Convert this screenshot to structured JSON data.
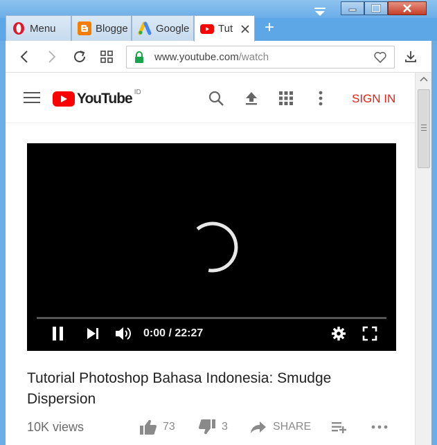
{
  "browser": {
    "tabs": [
      {
        "label": "Menu",
        "favicon": "opera-logo-icon"
      },
      {
        "label": "Blogge",
        "favicon": "blogger-icon"
      },
      {
        "label": "Google",
        "favicon": "google-ads-icon"
      },
      {
        "label": "Tut",
        "favicon": "youtube-icon",
        "active": true
      }
    ],
    "new_tab_label": "+",
    "url_host": "www.youtube.com",
    "url_path": "/watch"
  },
  "youtube": {
    "logo_text": "YouTube",
    "region": "ID",
    "sign_in": "SIGN IN",
    "accent": "#ff0000",
    "player": {
      "time": "0:00 / 22:27",
      "progress": 0
    },
    "video": {
      "title": "Tutorial Photoshop Bahasa Indonesia: Smudge Dispersion",
      "views": "10K views",
      "likes": "73",
      "dislikes": "3",
      "share": "SHARE"
    }
  }
}
